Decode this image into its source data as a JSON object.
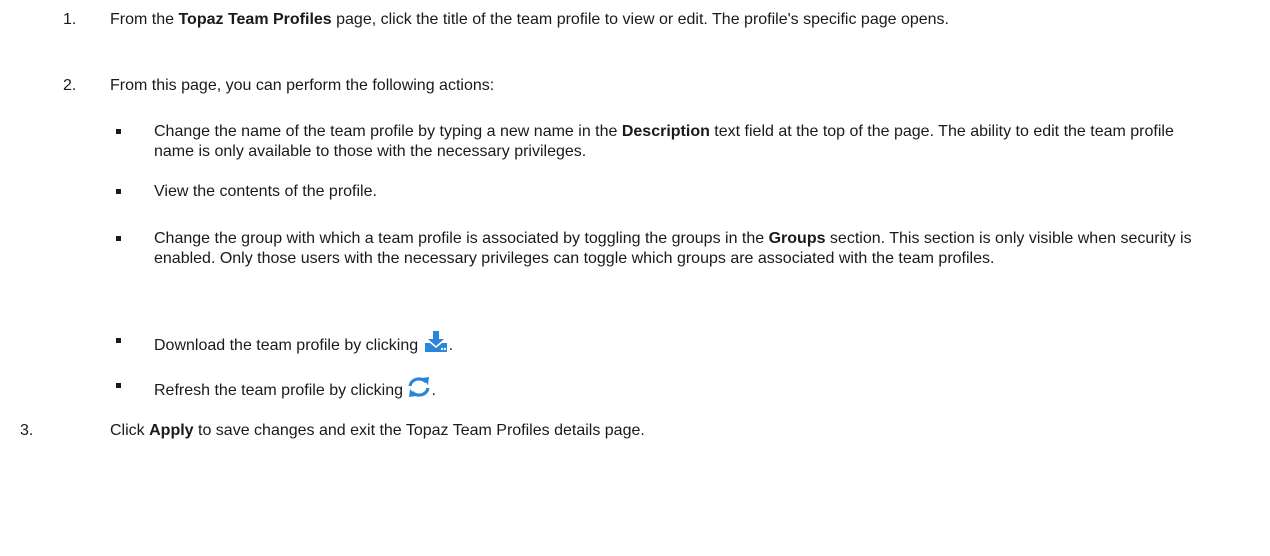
{
  "steps": [
    {
      "number": "1.",
      "pre": "From the ",
      "bold": "Topaz Team Profiles",
      "post": " page, click the title of the team profile to view or edit.  The profile's specific page opens."
    },
    {
      "number": "2.",
      "text": "From this page, you can perform the following actions:"
    },
    {
      "number": "3.",
      "pre": "Click ",
      "bold": "Apply",
      "post": " to save changes and exit the Topaz Team Profiles details page."
    }
  ],
  "bullets": [
    {
      "pre": "Change the name of the team profile by typing a new name in the ",
      "bold": "Description",
      "post": " text field at the top of the page. The ability to edit the team profile name is only available to those with the necessary privileges."
    },
    {
      "text": "View the contents of the profile."
    },
    {
      "pre": "Change the group with which a team profile is associated by toggling the groups in the ",
      "bold": "Groups",
      "post": " section. This section is only visible when security is enabled. Only those users with the necessary privileges can toggle which groups are associated with the team profiles."
    },
    {
      "pre": "Download the team profile by clicking ",
      "icon": "download-icon",
      "post": "."
    },
    {
      "pre": "Refresh the team profile by clicking ",
      "icon": "refresh-icon",
      "post": "."
    }
  ],
  "colors": {
    "icon_blue": "#2a86d6",
    "text": "#1a1a1a"
  }
}
